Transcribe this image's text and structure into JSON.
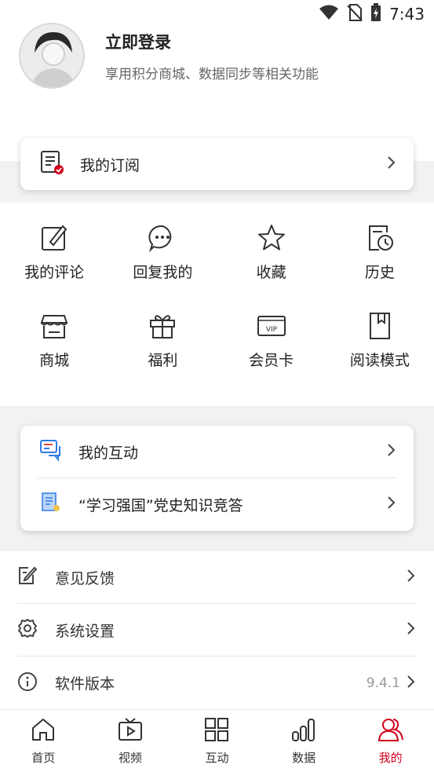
{
  "status_bar": {
    "time": "7:43"
  },
  "profile": {
    "title": "立即登录",
    "subtitle": "享用积分商城、数据同步等相关功能"
  },
  "subscription": {
    "label": "我的订阅"
  },
  "grid": [
    {
      "label": "我的评论",
      "icon": "edit-icon"
    },
    {
      "label": "回复我的",
      "icon": "chat-icon"
    },
    {
      "label": "收藏",
      "icon": "star-icon"
    },
    {
      "label": "历史",
      "icon": "history-icon"
    },
    {
      "label": "商城",
      "icon": "shop-icon"
    },
    {
      "label": "福利",
      "icon": "gift-icon"
    },
    {
      "label": "会员卡",
      "icon": "vip-card-icon"
    },
    {
      "label": "阅读模式",
      "icon": "bookmark-icon"
    }
  ],
  "interaction": {
    "items": [
      {
        "label": "我的互动",
        "icon": "chat-bubbles-icon"
      },
      {
        "label": "“学习强国”党史知识竞答",
        "icon": "document-icon"
      }
    ]
  },
  "settings": {
    "items": [
      {
        "label": "意见反馈",
        "icon": "feedback-icon",
        "value": ""
      },
      {
        "label": "系统设置",
        "icon": "gear-icon",
        "value": ""
      },
      {
        "label": "软件版本",
        "icon": "info-icon",
        "value": "9.4.1"
      }
    ]
  },
  "tabs": [
    {
      "label": "首页",
      "icon": "home-icon"
    },
    {
      "label": "视频",
      "icon": "tv-icon"
    },
    {
      "label": "互动",
      "icon": "grid-icon"
    },
    {
      "label": "数据",
      "icon": "bar-chart-icon"
    },
    {
      "label": "我的",
      "icon": "user-icon",
      "active": true
    }
  ],
  "colors": {
    "accent": "#d0021b",
    "background_band": "#f2f2f2",
    "blue_icon": "#2f7be5"
  }
}
